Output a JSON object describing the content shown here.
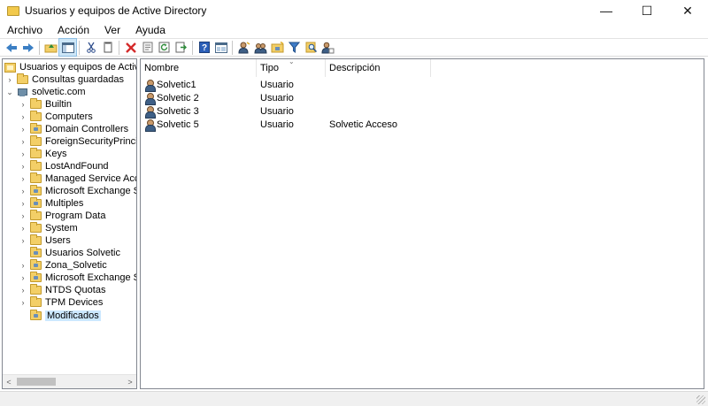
{
  "window": {
    "title": "Usuarios y equipos de Active Directory",
    "minimize_glyph": "—",
    "maximize_glyph": "☐",
    "close_glyph": "✕"
  },
  "menu": [
    "Archivo",
    "Acción",
    "Ver",
    "Ayuda"
  ],
  "toolbar": {
    "icons": [
      "back-icon",
      "forward-icon",
      "up-folder-icon",
      "show-hide-tree-icon",
      "cut-icon",
      "copy-icon",
      "delete-icon",
      "properties-icon",
      "refresh-icon",
      "export-list-icon",
      "help-icon",
      "console-icon",
      "new-user-icon",
      "new-group-icon",
      "new-ou-icon",
      "filter-icon",
      "find-icon",
      "add-to-group-icon"
    ]
  },
  "tree": {
    "root": "Usuarios y equipos de Active Dir",
    "saved_queries": "Consultas guardadas",
    "domain": "solvetic.com",
    "children": [
      {
        "label": "Builtin",
        "type": "container",
        "expandable": true
      },
      {
        "label": "Computers",
        "type": "container",
        "expandable": true
      },
      {
        "label": "Domain Controllers",
        "type": "ou",
        "expandable": true
      },
      {
        "label": "ForeignSecurityPrincipals",
        "type": "container",
        "expandable": true
      },
      {
        "label": "Keys",
        "type": "container",
        "expandable": true
      },
      {
        "label": "LostAndFound",
        "type": "container",
        "expandable": true
      },
      {
        "label": "Managed Service Accour",
        "type": "container",
        "expandable": true
      },
      {
        "label": "Microsoft Exchange Secu",
        "type": "ou",
        "expandable": true
      },
      {
        "label": "Multiples",
        "type": "ou",
        "expandable": true
      },
      {
        "label": "Program Data",
        "type": "container",
        "expandable": true
      },
      {
        "label": "System",
        "type": "container",
        "expandable": true
      },
      {
        "label": "Users",
        "type": "container",
        "expandable": true
      },
      {
        "label": "Usuarios Solvetic",
        "type": "ou",
        "expandable": false
      },
      {
        "label": "Zona_Solvetic",
        "type": "ou",
        "expandable": true
      },
      {
        "label": "Microsoft Exchange Syste",
        "type": "ou",
        "expandable": true
      },
      {
        "label": "NTDS Quotas",
        "type": "container",
        "expandable": true
      },
      {
        "label": "TPM Devices",
        "type": "container",
        "expandable": true
      },
      {
        "label": "Modificados",
        "type": "ou",
        "expandable": false,
        "selected": true
      }
    ]
  },
  "list": {
    "columns": [
      "Nombre",
      "Tipo",
      "Descripción"
    ],
    "sort_glyph": "⌄",
    "rows": [
      {
        "name": "Solvetic1",
        "type": "Usuario",
        "description": ""
      },
      {
        "name": "Solvetic 2",
        "type": "Usuario",
        "description": ""
      },
      {
        "name": "Solvetic 3",
        "type": "Usuario",
        "description": ""
      },
      {
        "name": "Solvetic 5",
        "type": "Usuario",
        "description": "Solvetic Acceso"
      }
    ]
  },
  "scroll": {
    "left_glyph": "<",
    "right_glyph": ">"
  }
}
